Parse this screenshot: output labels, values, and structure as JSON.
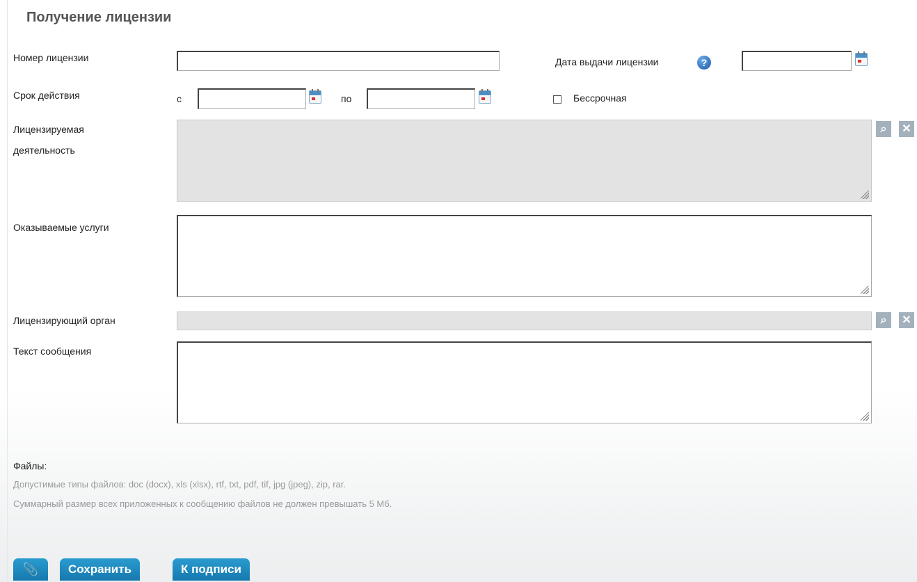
{
  "page": {
    "title": "Получение лицензии"
  },
  "form": {
    "license_number": {
      "label": "Номер лицензии",
      "value": ""
    },
    "issue_date": {
      "label": "Дата выдачи лицензии",
      "value": ""
    },
    "validity": {
      "label": "Срок действия",
      "from_label": "с",
      "to_label": "по",
      "from_value": "",
      "to_value": ""
    },
    "indefinite": {
      "label": "Бессрочная",
      "checked": false
    },
    "licensed_activity": {
      "label_line1": "Лицензируемая",
      "label_line2": "деятельность",
      "value": ""
    },
    "services": {
      "label": "Оказываемые услуги",
      "value": ""
    },
    "licensing_body": {
      "label": "Лицензирующий орган",
      "value": ""
    },
    "message_text": {
      "label": "Текст сообщения",
      "value": ""
    }
  },
  "files": {
    "label": "Файлы:",
    "allowed_types": "Допустимые типы файлов: doc (docx), xls (xlsx), rtf, txt, pdf, tif, jpg (jpeg), zip, rar.",
    "size_limit": "Суммарный размер всех приложенных к сообщению файлов не должен превышать 5 Мб."
  },
  "actions": {
    "save_label": "Сохранить",
    "sign_label": "К подписи"
  },
  "icons": {
    "help": "help-icon",
    "calendar": "calendar-icon",
    "search": "search-icon",
    "clear": "close-icon",
    "attach": "paperclip-icon"
  }
}
